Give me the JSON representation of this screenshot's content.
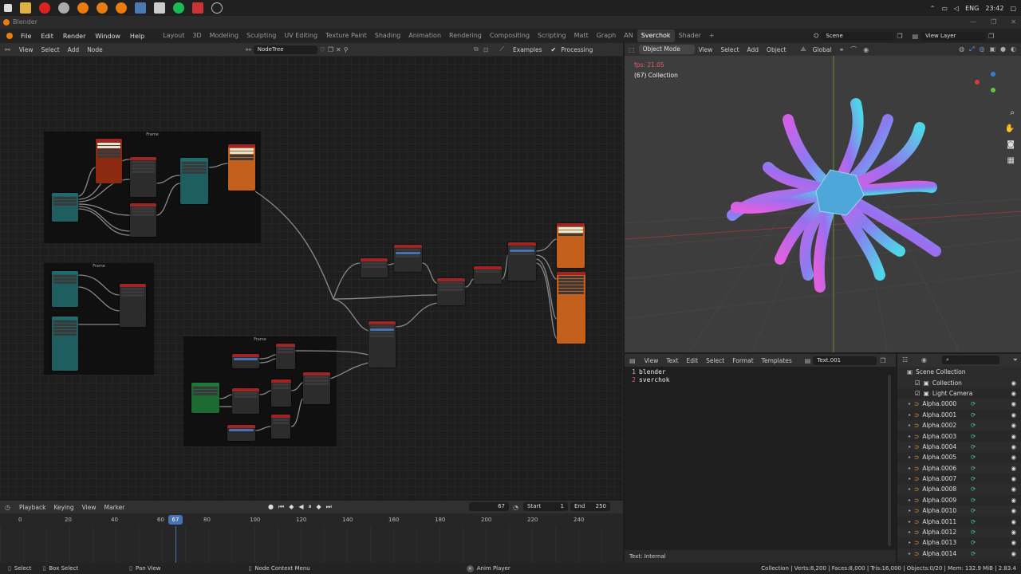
{
  "window": {
    "title": "Blender"
  },
  "taskbar": {
    "lang": "ENG",
    "time": "23:42"
  },
  "menubar": {
    "items": [
      "File",
      "Edit",
      "Render",
      "Window",
      "Help"
    ],
    "workspaces": [
      "Layout",
      "3D",
      "Modeling",
      "Sculpting",
      "UV Editing",
      "Texture Paint",
      "Shading",
      "Animation",
      "Rendering",
      "Compositing",
      "Scripting",
      "Matt",
      "Graph",
      "AN",
      "Sverchok",
      "Shader"
    ],
    "active_workspace": "Sverchok",
    "scene": "Scene",
    "view_layer": "View Layer"
  },
  "node_editor": {
    "menus": [
      "View",
      "Select",
      "Add",
      "Node"
    ],
    "tree_name": "NodeTree",
    "examples_label": "Examples",
    "processing_label": "Processing",
    "frames": [
      "Frame",
      "Frame",
      "Frame"
    ]
  },
  "viewport": {
    "mode": "Object Mode",
    "menus": [
      "View",
      "Select",
      "Add",
      "Object"
    ],
    "orientation": "Global",
    "fps": "fps: 21.05",
    "collection_label": "(67) Collection"
  },
  "text_editor": {
    "menus": [
      "View",
      "Text",
      "Edit",
      "Select",
      "Format",
      "Templates"
    ],
    "file_name": "Text.001",
    "lines": [
      {
        "num": "1",
        "text": "blender"
      },
      {
        "num": "2",
        "text": "sverchok"
      }
    ],
    "footer": "Text: Internal"
  },
  "outliner": {
    "scene_collection": "Scene Collection",
    "items": [
      "Collection",
      "Light Camera",
      "Alpha.0000",
      "Alpha.0001",
      "Alpha.0002",
      "Alpha.0003",
      "Alpha.0004",
      "Alpha.0005",
      "Alpha.0006",
      "Alpha.0007",
      "Alpha.0008",
      "Alpha.0009",
      "Alpha.0010",
      "Alpha.0011",
      "Alpha.0012",
      "Alpha.0013",
      "Alpha.0014"
    ]
  },
  "timeline": {
    "menus": [
      "Playback",
      "Keying",
      "View",
      "Marker"
    ],
    "current_frame": "67",
    "start_label": "Start",
    "start": "1",
    "end_label": "End",
    "end": "250",
    "ticks": [
      "0",
      "20",
      "40",
      "60",
      "80",
      "100",
      "120",
      "140",
      "160",
      "180",
      "200",
      "220",
      "240"
    ]
  },
  "statusbar": {
    "select": "Select",
    "box_select": "Box Select",
    "pan_view": "Pan View",
    "node_context": "Node Context Menu",
    "anim_player": "Anim Player",
    "stats": "Collection | Verts:8,200 | Faces:8,000 | Tris:16,000 | Objects:0/20 | Mem: 132.9 MiB | 2.83.4"
  },
  "colors": {
    "accent": "#4772b3",
    "frame_marker": "#4a8fd4",
    "tube_pink": "#d25fe6",
    "tube_cyan": "#4fd6e6"
  }
}
